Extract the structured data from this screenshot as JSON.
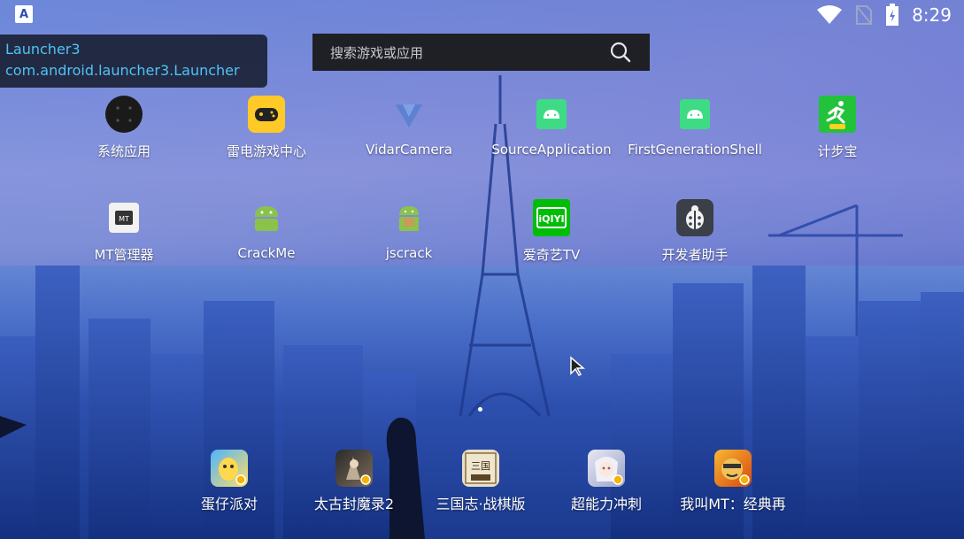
{
  "status_bar": {
    "left_icon": "A",
    "time": "8:29",
    "icons": [
      "wifi-icon",
      "no-sim-icon",
      "battery-charging-icon"
    ]
  },
  "debug_overlay": {
    "line1": "Launcher3",
    "line2": "com.android.launcher3.Launcher"
  },
  "search": {
    "placeholder": "搜索游戏或应用",
    "icon": "search-icon"
  },
  "apps_row1": [
    {
      "label": "系统应用",
      "icon": "folder-icon"
    },
    {
      "label": "雷电游戏中心",
      "icon": "gamepad-icon"
    },
    {
      "label": "VidarCamera",
      "icon": "vidar-icon"
    },
    {
      "label": "SourceApplication",
      "icon": "android-icon"
    },
    {
      "label": "FirstGenerationShell",
      "icon": "android-icon"
    },
    {
      "label": "计步宝",
      "icon": "runner-icon"
    }
  ],
  "apps_row2": [
    {
      "label": "MT管理器",
      "icon": "mt-icon"
    },
    {
      "label": "CrackMe",
      "icon": "android-icon"
    },
    {
      "label": "jscrack",
      "icon": "android-box-icon"
    },
    {
      "label": "爱奇艺TV",
      "icon": "iqiyi-icon"
    },
    {
      "label": "开发者助手",
      "icon": "ladybug-icon"
    }
  ],
  "dock": [
    {
      "label": "蛋仔派对",
      "icon": "eggy-party-icon"
    },
    {
      "label": "太古封魔录2",
      "icon": "game-icon"
    },
    {
      "label": "三国志·战棋版",
      "icon": "sanguo-icon"
    },
    {
      "label": "超能力冲刺",
      "icon": "anime-girl-icon"
    },
    {
      "label": "我叫MT：经典再",
      "icon": "mt-game-icon"
    }
  ],
  "colors": {
    "overlay_text": "#4fc3f7",
    "android_green": "#3ddc84",
    "iqiyi_green": "#00be06",
    "game_yellow": "#ffc928"
  }
}
